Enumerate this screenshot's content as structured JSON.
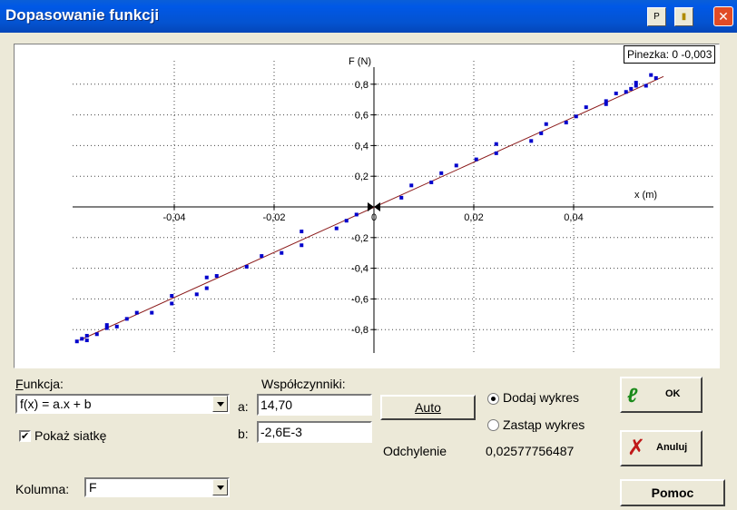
{
  "window": {
    "title": "Dopasowanie funkcji",
    "btn_p": "P",
    "btn_pin": "▪",
    "close": "✕"
  },
  "plot": {
    "pin_label": "Pinezka: 0 -0,003",
    "ylabel": "F (N)",
    "xlabel": "x (m)"
  },
  "chart_data": {
    "type": "scatter",
    "xlabel": "x (m)",
    "ylabel": "F (N)",
    "xlim": [
      -0.059,
      0.058
    ],
    "ylim": [
      -0.88,
      0.88
    ],
    "grid": true,
    "xticks": [
      "-0,04",
      "-0,02",
      "0",
      "0,02",
      "0,04"
    ],
    "xtick_values": [
      -0.04,
      -0.02,
      0,
      0.02,
      0.04
    ],
    "yticks": [
      "0,8",
      "0,6",
      "0,4",
      "0,2",
      "-0,2",
      "-0,4",
      "-0,6",
      "-0,8"
    ],
    "ytick_values": [
      0.8,
      0.6,
      0.4,
      0.2,
      -0.2,
      -0.4,
      -0.6,
      -0.8
    ],
    "series": [
      {
        "points": [
          [
            -0.0595,
            -0.877
          ],
          [
            -0.0585,
            -0.86
          ],
          [
            -0.0575,
            -0.84
          ],
          [
            -0.0575,
            -0.87
          ],
          [
            -0.0555,
            -0.83
          ],
          [
            -0.0535,
            -0.79
          ],
          [
            -0.0535,
            -0.77
          ],
          [
            -0.0515,
            -0.78
          ],
          [
            -0.0495,
            -0.73
          ],
          [
            -0.0475,
            -0.69
          ],
          [
            -0.0445,
            -0.69
          ],
          [
            -0.0405,
            -0.63
          ],
          [
            -0.0405,
            -0.58
          ],
          [
            -0.0355,
            -0.57
          ],
          [
            -0.0335,
            -0.53
          ],
          [
            -0.0335,
            -0.46
          ],
          [
            -0.0315,
            -0.45
          ],
          [
            -0.0255,
            -0.39
          ],
          [
            -0.0225,
            -0.32
          ],
          [
            -0.0185,
            -0.3
          ],
          [
            -0.0145,
            -0.25
          ],
          [
            -0.0145,
            -0.16
          ],
          [
            -0.0075,
            -0.14
          ],
          [
            -0.0055,
            -0.09
          ],
          [
            -0.0035,
            -0.05
          ],
          [
            0.0055,
            0.06
          ],
          [
            0.0075,
            0.14
          ],
          [
            0.0115,
            0.16
          ],
          [
            0.0135,
            0.22
          ],
          [
            0.0165,
            0.27
          ],
          [
            0.0205,
            0.31
          ],
          [
            0.0245,
            0.35
          ],
          [
            0.0245,
            0.41
          ],
          [
            0.0315,
            0.43
          ],
          [
            0.0335,
            0.48
          ],
          [
            0.0345,
            0.54
          ],
          [
            0.0385,
            0.55
          ],
          [
            0.0405,
            0.59
          ],
          [
            0.0425,
            0.65
          ],
          [
            0.0465,
            0.67
          ],
          [
            0.0465,
            0.69
          ],
          [
            0.0485,
            0.74
          ],
          [
            0.0505,
            0.75
          ],
          [
            0.0515,
            0.77
          ],
          [
            0.0525,
            0.81
          ],
          [
            0.0525,
            0.79
          ],
          [
            0.0545,
            0.79
          ],
          [
            0.0565,
            0.84
          ],
          [
            0.0555,
            0.86
          ]
        ]
      }
    ],
    "fit": {
      "a": 14.7,
      "b": -0.0026,
      "color": "#8b1a1a"
    },
    "point_color": "#0000cc"
  },
  "controls": {
    "funkcja_label": "Funkcja:",
    "funkcja_value": "f(x) = a.x + b",
    "pokaz_label": "Pokaż siatkę",
    "pokaz_checked": "✔",
    "kolumna_label": "Kolumna:",
    "kolumna_value": "F",
    "wspolczynniki_label": "Współczynniki:",
    "a_label": "a:",
    "a_value": "14,70",
    "b_label": "b:",
    "b_value": "-2,6E-3",
    "auto_label": "Auto",
    "dodaj_label": "Dodaj wykres",
    "zastap_label": "Zastąp wykres",
    "odchylenie_label": "Odchylenie",
    "odchylenie_value": "0,02577756487",
    "ok_label": "OK",
    "anuluj_label": "Anuluj",
    "pomoc_label": "Pomoc"
  }
}
